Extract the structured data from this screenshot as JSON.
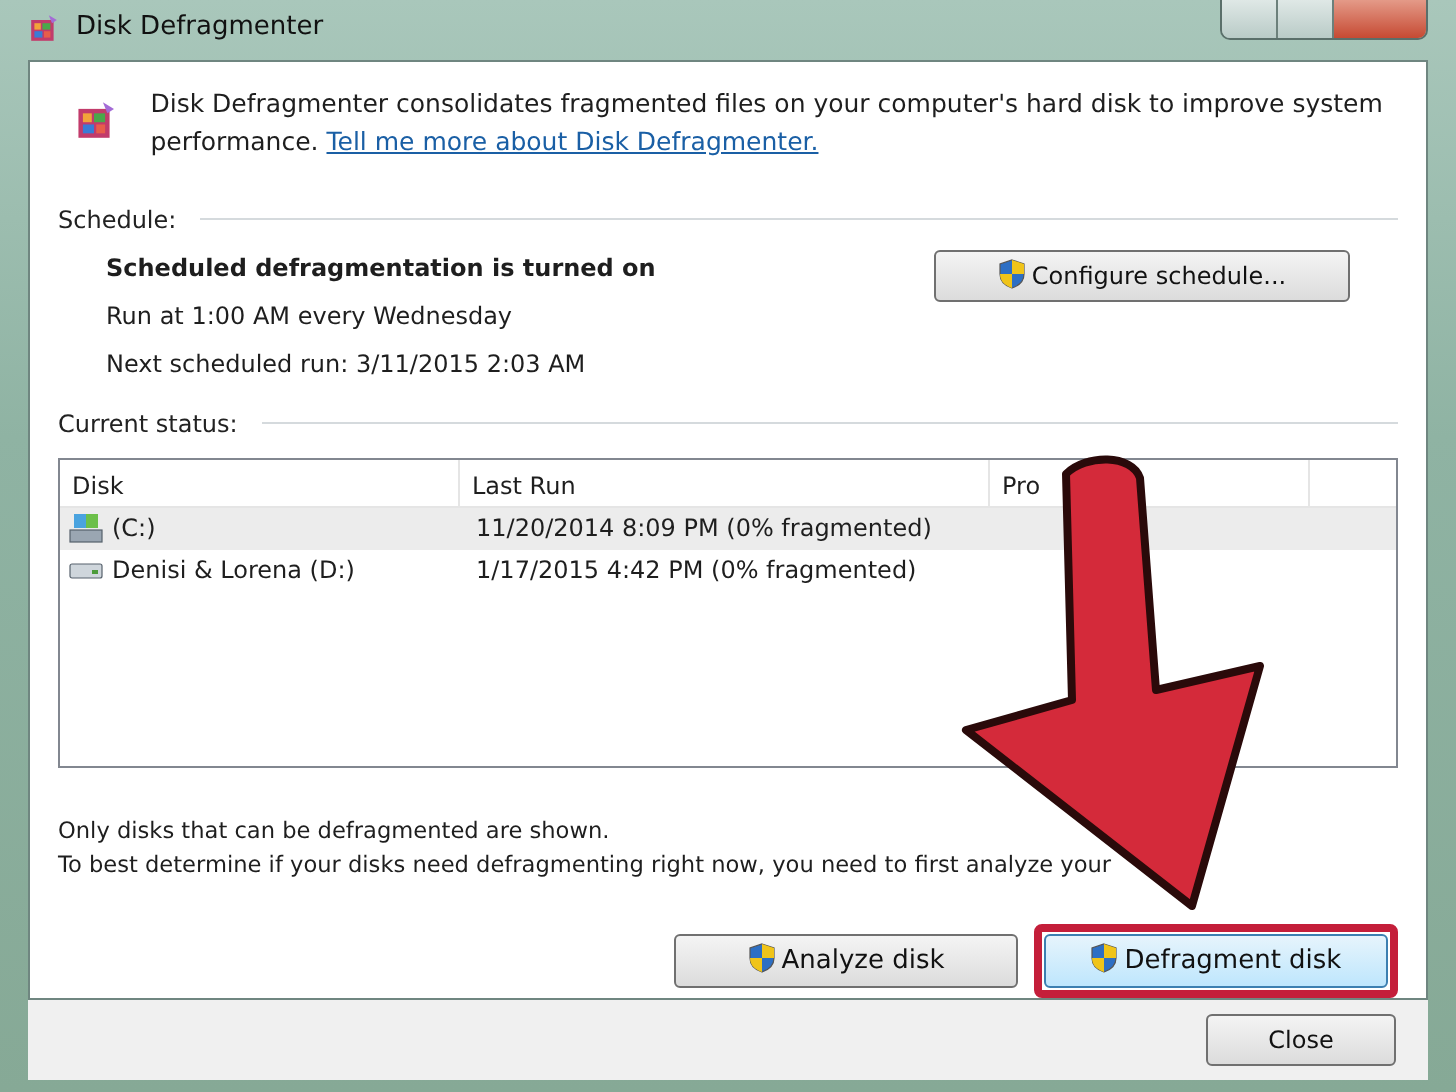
{
  "window": {
    "title": "Disk Defragmenter"
  },
  "intro": {
    "text": "Disk Defragmenter consolidates fragmented files on your computer's hard disk to improve system performance.",
    "link": "Tell me more about Disk Defragmenter."
  },
  "schedule": {
    "heading": "Schedule:",
    "status": "Scheduled defragmentation is turned on",
    "run": "Run at 1:00 AM every Wednesday",
    "next_run": "Next scheduled run: 3/11/2015 2:03 AM",
    "button": "Configure schedule..."
  },
  "current_status": {
    "heading": "Current status:",
    "columns": [
      "Disk",
      "Last Run",
      "Pro"
    ],
    "rows": [
      {
        "disk": "(C:)",
        "kind": "system",
        "last_run": "11/20/2014 8:09 PM (0% fragmented)",
        "selected": true
      },
      {
        "disk": "Denisi & Lorena (D:)",
        "kind": "drive",
        "last_run": "1/17/2015 4:42 PM (0% fragmented)",
        "selected": false
      }
    ]
  },
  "notes": [
    "Only disks that can be defragmented are shown.",
    "To best determine if your disks need defragmenting right now, you need to first analyze your"
  ],
  "buttons": [
    {
      "label": "Analyze disk",
      "highlighted": false
    },
    {
      "label": "Defragment disk",
      "highlighted": true
    }
  ],
  "close_button": "Close"
}
